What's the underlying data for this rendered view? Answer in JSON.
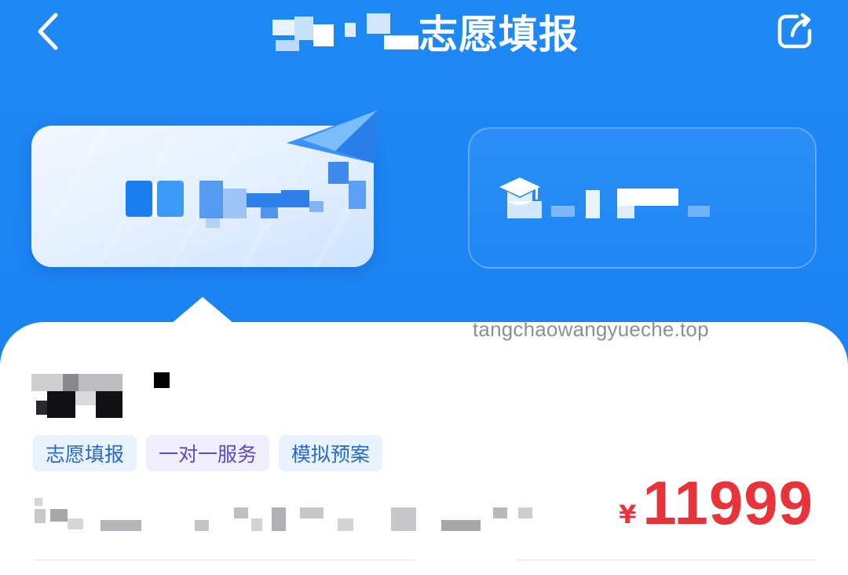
{
  "header": {
    "title": "志愿填报",
    "back_icon": "chevron-left-icon",
    "share_icon": "share-icon"
  },
  "cards": {
    "left": {
      "icon": "book-icon",
      "decor_icon": "paper-plane-icon"
    },
    "right": {
      "icon": "graduation-cap-icon"
    }
  },
  "watermark": "tangchaowangyueche.top",
  "product": {
    "tags": [
      {
        "label": "志愿填报"
      },
      {
        "label": "一对一服务"
      },
      {
        "label": "模拟预案"
      }
    ],
    "price": {
      "currency": "¥",
      "amount": "11999"
    }
  },
  "colors": {
    "brand_blue": "#1e88f4",
    "price_red": "#e8333a",
    "tag_blue_text": "#2b69c7",
    "tag_purple_text": "#5a4cc6"
  }
}
